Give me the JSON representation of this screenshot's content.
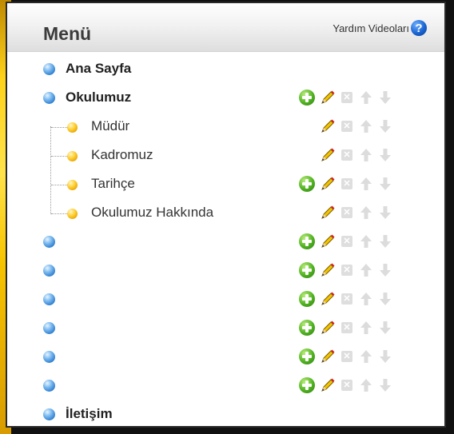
{
  "header": {
    "title": "Menü",
    "help_label": "Yardım Videoları",
    "help_icon": "question-icon"
  },
  "colors": {
    "accent_yellow": "#ffd21a",
    "bullet_blue": "#2f7fd1",
    "bullet_yellow": "#e8a400",
    "add_green": "#4fb121",
    "disabled_gray": "#dedede"
  },
  "rows": [
    {
      "label": "Ana Sayfa",
      "level": 0,
      "actions": []
    },
    {
      "label": "Okulumuz",
      "level": 0,
      "actions": [
        "add",
        "edit",
        "delete",
        "up",
        "down"
      ]
    },
    {
      "label": "Müdür",
      "level": 1,
      "actions": [
        "edit",
        "delete",
        "up",
        "down"
      ]
    },
    {
      "label": "Kadromuz",
      "level": 1,
      "actions": [
        "edit",
        "delete",
        "up",
        "down"
      ]
    },
    {
      "label": "Tarihçe",
      "level": 1,
      "actions": [
        "add",
        "edit",
        "delete",
        "up",
        "down"
      ]
    },
    {
      "label": "Okulumuz Hakkında",
      "level": 1,
      "actions": [
        "edit",
        "delete",
        "up",
        "down"
      ]
    },
    {
      "label": "",
      "level": 0,
      "actions": [
        "add",
        "edit",
        "delete",
        "up",
        "down"
      ]
    },
    {
      "label": "",
      "level": 0,
      "actions": [
        "add",
        "edit",
        "delete",
        "up",
        "down"
      ]
    },
    {
      "label": "",
      "level": 0,
      "actions": [
        "add",
        "edit",
        "delete",
        "up",
        "down"
      ]
    },
    {
      "label": "",
      "level": 0,
      "actions": [
        "add",
        "edit",
        "delete",
        "up",
        "down"
      ]
    },
    {
      "label": "",
      "level": 0,
      "actions": [
        "add",
        "edit",
        "delete",
        "up",
        "down"
      ]
    },
    {
      "label": "",
      "level": 0,
      "actions": [
        "add",
        "edit",
        "delete",
        "up",
        "down"
      ]
    },
    {
      "label": "İletişim",
      "level": 0,
      "actions": []
    }
  ]
}
